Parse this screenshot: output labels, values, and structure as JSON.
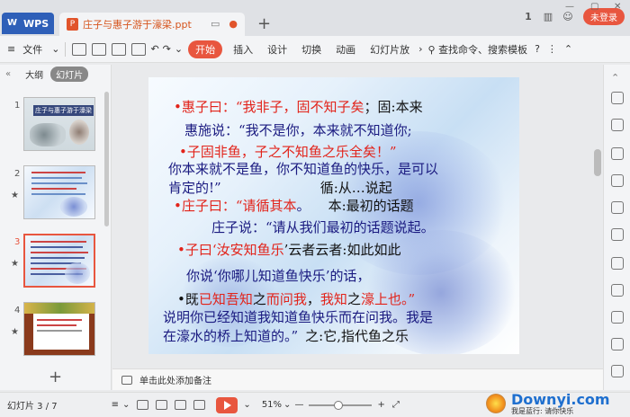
{
  "tabs": {
    "app_label": "WPS",
    "doc_title": "庄子与惠子游于濠梁.ppt",
    "login_label": "未登录"
  },
  "toolbar": {
    "file_label": "文件",
    "start_label": "开始",
    "insert_label": "插入",
    "design_label": "设计",
    "transition_label": "切换",
    "animation_label": "动画",
    "slideshow_label": "幻灯片放",
    "search_label": "查找命令、搜索模板"
  },
  "sidebar": {
    "outline_tab": "大纲",
    "slides_tab": "幻灯片",
    "slides": [
      {
        "num": "1",
        "title": "庄子与惠子游于濠梁"
      },
      {
        "num": "2"
      },
      {
        "num": "3"
      },
      {
        "num": "4"
      }
    ]
  },
  "slide": {
    "l1a": "•惠子曰：“我非子，固",
    "l1b": "不知子矣",
    "l1c": "；固:本来",
    "l2": "惠施说：“我不是你，本来就不知道你;",
    "l3": "•子固非鱼，子之不知鱼之乐全矣！”",
    "l4": "你本来就不是鱼，你不知道鱼的快乐，是可以",
    "l5a": "肯定的!”",
    "l5b": "循:从…说起",
    "l6a": "•庄子曰：“",
    "l6b": "请循其本",
    "l6c": "。",
    "l6d": "本:最初的话题",
    "l7": "庄子说：“请从我们最初的话题说起。",
    "l8a": "•子曰‘",
    "l8b": "汝安知鱼乐",
    "l8c": "’云者",
    "l8d": "云者:如此如此",
    "l9": "你说‘你哪儿知道鱼快乐’的话，",
    "l10a": "•既",
    "l10b": "已知吾知",
    "l10c": "之",
    "l10d": "而问我",
    "l10e": "，",
    "l10f": "我知",
    "l10g": "之",
    "l10h": "濠上也",
    "l10i": "。”",
    "l11": "说明你已经知道我知道鱼快乐而在问我。我是",
    "l12a": "在濠水的桥上知道的。”",
    "l12b": "之:它,指代鱼之乐"
  },
  "notes": {
    "placeholder": "单击此处添加备注"
  },
  "status": {
    "slide_counter": "幻灯片 3 / 7",
    "zoom": "51%"
  },
  "watermark": {
    "text": "Downyi.com",
    "sub": "我是蓝行: 请你快乐"
  },
  "colors": {
    "accent": "#e8563f",
    "wps_blue": "#2e5fb8",
    "slide_red": "#e2231a",
    "slide_blue": "#1a1a80"
  }
}
